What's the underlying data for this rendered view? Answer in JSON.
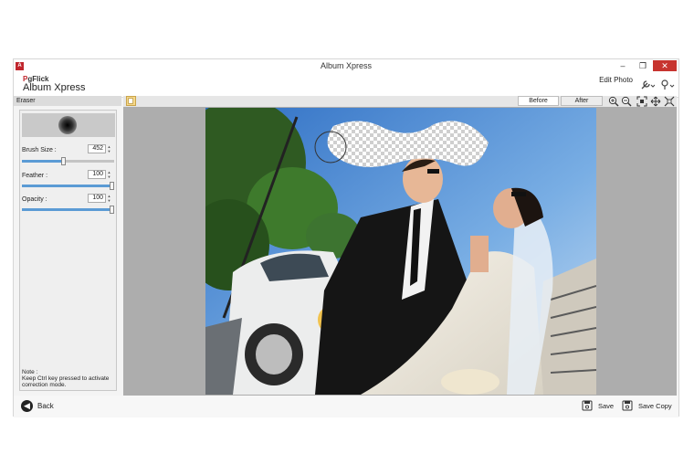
{
  "window": {
    "title": "Album Xpress",
    "controls": [
      "–",
      "❐",
      "✕"
    ]
  },
  "header": {
    "logo_prefix": "P",
    "logo_rest": "gFlick",
    "app_name": "Album Xpress",
    "edit_photo": "Edit Photo"
  },
  "panel": {
    "title": "Eraser",
    "brush_size": {
      "label": "Brush Size :",
      "value": "452",
      "level": 0.45
    },
    "feather": {
      "label": "Feather :",
      "value": "100",
      "level": 1.0
    },
    "opacity": {
      "label": "Opacity :",
      "value": "100",
      "level": 1.0
    },
    "note_title": "Note :",
    "note_text": "Keep Ctrl key pressed to activate correction mode."
  },
  "view": {
    "before_label": "Before",
    "after_label": "After",
    "selected": "Before"
  },
  "footer": {
    "back_label": "Back",
    "save_label": "Save",
    "save_copy_label": "Save Copy"
  },
  "colors": {
    "accent": "#5b9bd5",
    "brand": "#c0262d",
    "canvas_bg": "#adadad"
  },
  "icons": [
    "zoom-in-icon",
    "zoom-out-icon",
    "fit-icon",
    "pan-icon",
    "fullscreen-icon",
    "wrench-icon",
    "help-icon",
    "save-icon",
    "save-copy-icon",
    "back-arrow-icon"
  ]
}
